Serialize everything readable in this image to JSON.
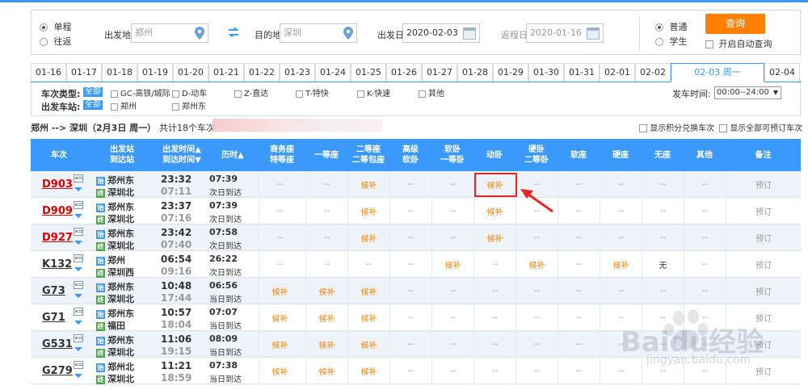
{
  "search": {
    "trip_types": [
      "单程",
      "往返"
    ],
    "from_label": "出发地",
    "from_value": "郑州",
    "to_label": "目的地",
    "to_value": "深圳",
    "depart_label": "出发日",
    "depart_value": "2020-02-03",
    "return_label": "返程日",
    "return_value": "2020-01-16",
    "passenger_types": [
      "普通",
      "学生"
    ],
    "query_button": "查询",
    "auto_query": "开启自动查询"
  },
  "date_tabs": [
    "01-16",
    "01-17",
    "01-18",
    "01-19",
    "01-20",
    "01-21",
    "01-22",
    "01-23",
    "01-24",
    "01-25",
    "01-26",
    "01-27",
    "01-28",
    "01-29",
    "01-30",
    "01-31",
    "02-01",
    "02-02",
    "02-03 周一",
    "02-04"
  ],
  "filter": {
    "type_label": "车次类型:",
    "station_label": "出发车站:",
    "all_label": "全部",
    "types": [
      "GC-高铁/城际",
      "D-动车",
      "Z-直达",
      "T-特快",
      "K-快速",
      "其他"
    ],
    "stations": [
      "郑州",
      "郑州东"
    ],
    "time_label": "发车时间:",
    "time_value": "00:00--24:00"
  },
  "summary": {
    "route": "郑州 --> 深圳（2月3日 周一）",
    "count": "共计18个车次",
    "opt_points": "显示积分兑换车次",
    "opt_all": "显示全部可预订车次"
  },
  "headers": {
    "train": "车次",
    "stations": [
      "出发站",
      "到达站"
    ],
    "times": [
      "出发时间▲",
      "到达时间▼"
    ],
    "duration": "历时▲",
    "business": [
      "商务座",
      "特等座"
    ],
    "first": "一等座",
    "second": [
      "二等座",
      "二等包座"
    ],
    "adv_soft": [
      "高级",
      "软卧"
    ],
    "soft_sleeper": [
      "软卧",
      "一等卧"
    ],
    "moving_sleeper": "动卧",
    "hard_sleeper": [
      "硬卧",
      "二等卧"
    ],
    "soft_seat": "软座",
    "hard_seat": "硬座",
    "no_seat": "无座",
    "other": "其他",
    "remark": "备注"
  },
  "trains": [
    {
      "no": "D903",
      "red": true,
      "from": "郑州东",
      "to": "深圳北",
      "dep": "23:32",
      "arr": "07:11",
      "dur": "07:39",
      "day": "次日到达",
      "seats": [
        "--",
        "--",
        "候补",
        "--",
        "--",
        "候补",
        "--",
        "--",
        "--",
        "--",
        "--"
      ],
      "book": "预订"
    },
    {
      "no": "D909",
      "red": true,
      "from": "郑州东",
      "to": "深圳北",
      "dep": "23:37",
      "arr": "07:16",
      "dur": "07:39",
      "day": "次日到达",
      "seats": [
        "--",
        "--",
        "候补",
        "--",
        "--",
        "候补",
        "--",
        "--",
        "--",
        "--",
        "--"
      ],
      "book": "预订"
    },
    {
      "no": "D927",
      "red": true,
      "from": "郑州东",
      "to": "深圳北",
      "dep": "23:42",
      "arr": "07:40",
      "dur": "07:58",
      "day": "次日到达",
      "seats": [
        "--",
        "--",
        "候补",
        "--",
        "--",
        "候补",
        "--",
        "--",
        "--",
        "--",
        "--"
      ],
      "book": "预订"
    },
    {
      "no": "K132",
      "red": false,
      "from": "郑州",
      "to": "深圳西",
      "dep": "06:54",
      "arr": "09:16",
      "dur": "26:22",
      "day": "次日到达",
      "seats": [
        "--",
        "--",
        "--",
        "--",
        "候补",
        "--",
        "候补",
        "--",
        "候补",
        "无",
        "--"
      ],
      "book": "预订"
    },
    {
      "no": "G73",
      "red": false,
      "from": "郑州东",
      "to": "深圳北",
      "dep": "10:48",
      "arr": "17:44",
      "dur": "06:56",
      "day": "当日到达",
      "seats": [
        "候补",
        "候补",
        "候补",
        "--",
        "--",
        "--",
        "--",
        "--",
        "--",
        "--",
        "--"
      ],
      "book": "预订"
    },
    {
      "no": "G71",
      "red": false,
      "from": "郑州东",
      "to": "福田",
      "dep": "10:57",
      "arr": "18:04",
      "dur": "07:07",
      "day": "当日到达",
      "seats": [
        "候补",
        "候补",
        "候补",
        "--",
        "--",
        "--",
        "--",
        "--",
        "--",
        "--",
        "--"
      ],
      "book": "预订"
    },
    {
      "no": "G531",
      "red": false,
      "from": "郑州东",
      "to": "深圳北",
      "dep": "11:06",
      "arr": "19:15",
      "dur": "08:09",
      "day": "当日到达",
      "seats": [
        "候补",
        "候补",
        "候补",
        "--",
        "--",
        "--",
        "--",
        "--",
        "--",
        "--",
        "--"
      ],
      "book": "预订"
    },
    {
      "no": "G279",
      "red": false,
      "from": "郑州北",
      "to": "深圳北",
      "dep": "11:21",
      "arr": "18:59",
      "dur": "07:38",
      "day": "当日到达",
      "seats": [
        "候补",
        "候补",
        "候补",
        "--",
        "--",
        "--",
        "--",
        "--",
        "--",
        "--",
        "--"
      ],
      "book": "预订"
    }
  ],
  "seat_available_text": "候补",
  "colors": {
    "accent": "#3b99fc",
    "orange": "#ff8000",
    "red": "#e00000",
    "highlight": "#e8261f"
  },
  "watermark": {
    "text": "Baidu经验",
    "sub": "jingyan.baidu.com"
  },
  "icons": [
    "location-pin-icon",
    "swap-icon",
    "calendar-icon",
    "card-icon",
    "dropdown-icon",
    "start-station-icon",
    "end-station-icon"
  ]
}
